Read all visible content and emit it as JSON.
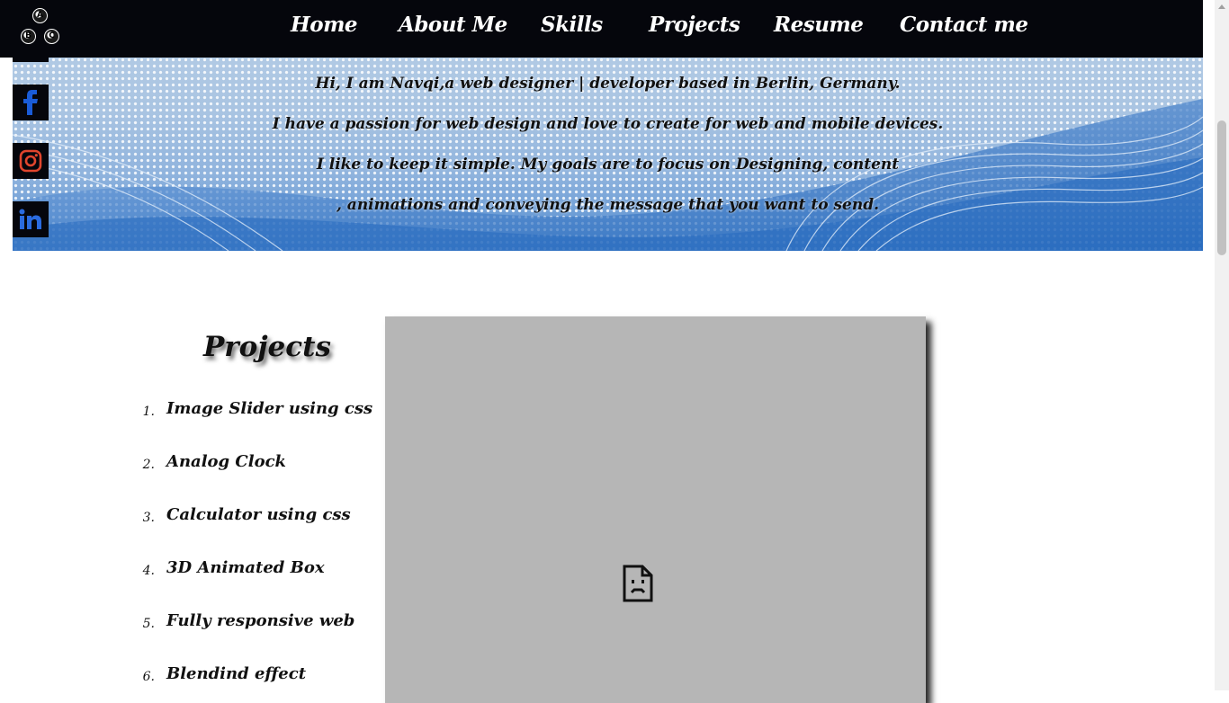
{
  "nav": {
    "logo_letters": [
      "A",
      "B",
      "C"
    ],
    "links": [
      "Home",
      "About Me",
      "Skills",
      "Projects",
      "Resume",
      "Contact me"
    ]
  },
  "social": [
    {
      "name": "facebook",
      "icon": "facebook-icon",
      "color": "#1877f2"
    },
    {
      "name": "instagram",
      "icon": "instagram-icon",
      "color": "#e1306c"
    },
    {
      "name": "linkedin",
      "icon": "linkedin-icon",
      "color": "#1d6bd6"
    }
  ],
  "hero": {
    "lines": [
      "Hi, I am Navqi,a web designer | developer based in Berlin, Germany.",
      "I have a passion for web design and love to create for web and mobile devices.",
      "I like to keep it simple. My goals are to focus on Designing, content",
      ", animations and conveying the message that you want to send."
    ]
  },
  "projects": {
    "title": "Projects",
    "items": [
      {
        "num": "1.",
        "label": "Image Slider using css"
      },
      {
        "num": "2.",
        "label": "Analog Clock"
      },
      {
        "num": "3.",
        "label": "Calculator using css"
      },
      {
        "num": "4.",
        "label": "3D Animated Box"
      },
      {
        "num": "5.",
        "label": "Fully responsive web"
      },
      {
        "num": "6.",
        "label": "Blendind effect"
      }
    ],
    "preview_icon": "broken-page-icon"
  },
  "colors": {
    "nav_bg": "#05060c",
    "preview_bg": "#b6b6b6"
  }
}
